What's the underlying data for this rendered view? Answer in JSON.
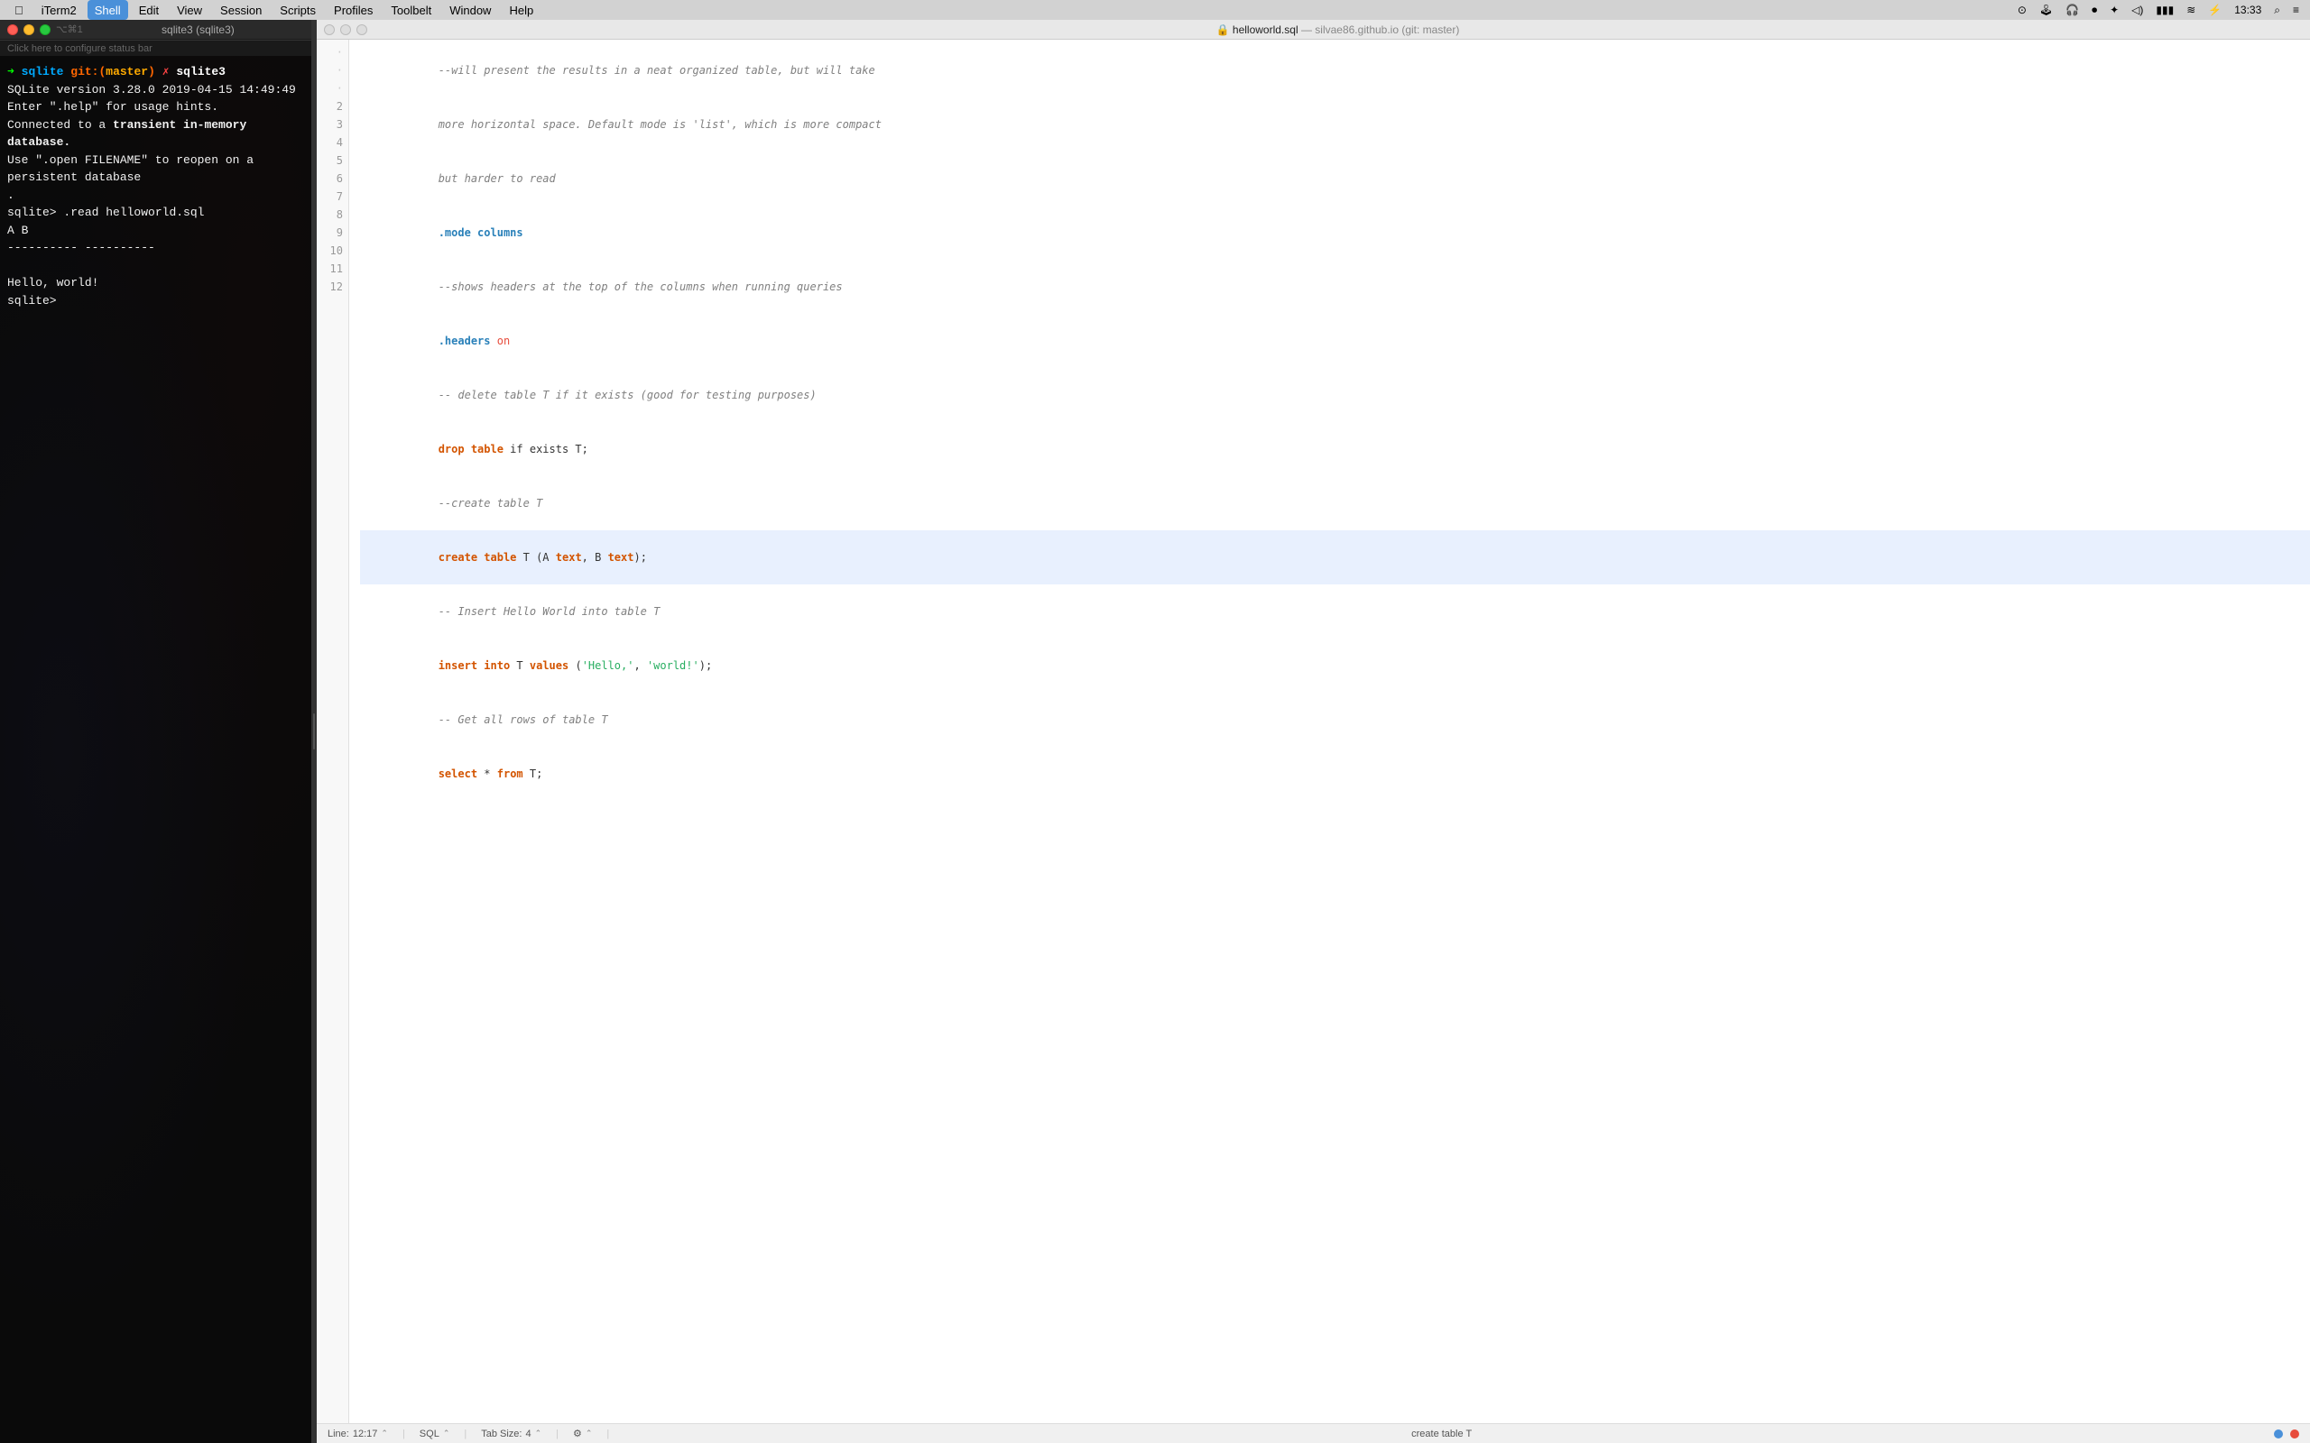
{
  "menubar": {
    "apple": "⌘",
    "items": [
      {
        "id": "iterm2",
        "label": "iTerm2"
      },
      {
        "id": "shell",
        "label": "Shell"
      },
      {
        "id": "edit",
        "label": "Edit"
      },
      {
        "id": "view",
        "label": "View"
      },
      {
        "id": "session",
        "label": "Session"
      },
      {
        "id": "scripts",
        "label": "Scripts"
      },
      {
        "id": "profiles",
        "label": "Profiles"
      },
      {
        "id": "toolbelt",
        "label": "Toolbelt"
      },
      {
        "id": "window",
        "label": "Window"
      },
      {
        "id": "help",
        "label": "Help"
      }
    ],
    "right": {
      "time": "13:33"
    }
  },
  "terminal": {
    "title": "sqlite3 (sqlite3)",
    "shortcut": "⌥⌘1",
    "status_bar_text": "Click here to configure status bar",
    "lines": [
      {
        "type": "prompt",
        "dir": "sqlite",
        "git_label": "git:(",
        "branch": "master",
        "git_close": ")",
        "cross": "✗",
        "cmd": "sqlite3"
      },
      {
        "type": "text",
        "content": "SQLite version 3.28.0 2019-04-15 14:49:49"
      },
      {
        "type": "text",
        "content": "Enter \".help\" for usage hints."
      },
      {
        "type": "text_mixed",
        "plain1": "Connected to a ",
        "bold": "transient in-memory database.",
        "plain2": ""
      },
      {
        "type": "text",
        "content": "Use \".open FILENAME\" to reopen on a persistent database"
      },
      {
        "type": "text",
        "content": "."
      },
      {
        "type": "sqlite_prompt",
        "cmd": ".read helloworld.sql"
      },
      {
        "type": "text",
        "content": "A               B"
      },
      {
        "type": "text",
        "content": "----------  ----------"
      },
      {
        "type": "text",
        "content": ""
      },
      {
        "type": "text",
        "content": "Hello,      world!"
      },
      {
        "type": "sqlite_empty_prompt",
        "content": ""
      }
    ]
  },
  "editor": {
    "title_dim1": "helloworld.sql",
    "title_dim2": " — silvae86.github.io (git: master)",
    "lines": [
      {
        "num": "·",
        "dot": true,
        "tokens": [
          {
            "type": "comment",
            "text": "--will present the results in a neat organized table, but will take"
          }
        ]
      },
      {
        "num": "·",
        "dot": true,
        "tokens": [
          {
            "type": "comment",
            "text": "more horizontal space. Default mode is 'list', which is more compact"
          }
        ]
      },
      {
        "num": "·",
        "dot": true,
        "tokens": [
          {
            "type": "comment",
            "text": "but harder to read"
          }
        ]
      },
      {
        "num": "2",
        "tokens": [
          {
            "type": "directive",
            "text": ".mode columns"
          }
        ]
      },
      {
        "num": "3",
        "tokens": [
          {
            "type": "comment",
            "text": "--shows headers at the top of the columns when running queries"
          }
        ]
      },
      {
        "num": "4",
        "tokens": [
          {
            "type": "directive",
            "text": ".headers "
          },
          {
            "type": "on",
            "text": "on"
          }
        ]
      },
      {
        "num": "5",
        "tokens": [
          {
            "type": "comment",
            "text": "-- delete table T if it exists (good for testing purposes)"
          }
        ]
      },
      {
        "num": "6",
        "tokens": [
          {
            "type": "keyword",
            "text": "drop table "
          },
          {
            "type": "normal",
            "text": "if exists T;"
          }
        ]
      },
      {
        "num": "7",
        "tokens": [
          {
            "type": "comment",
            "text": "--create table T"
          }
        ]
      },
      {
        "num": "8",
        "highlight": true,
        "tokens": [
          {
            "type": "keyword",
            "text": "create table "
          },
          {
            "type": "normal",
            "text": "T (A "
          },
          {
            "type": "keyword",
            "text": "text"
          },
          {
            "type": "normal",
            "text": ", B "
          },
          {
            "type": "keyword",
            "text": "text"
          },
          {
            "type": "normal",
            "text": ");"
          }
        ]
      },
      {
        "num": "9",
        "tokens": [
          {
            "type": "comment",
            "text": "-- Insert Hello World into table T"
          }
        ]
      },
      {
        "num": "10",
        "tokens": [
          {
            "type": "keyword",
            "text": "insert into"
          },
          {
            "type": "normal",
            "text": " T "
          },
          {
            "type": "keyword",
            "text": "values"
          },
          {
            "type": "normal",
            "text": " ("
          },
          {
            "type": "string",
            "text": "'Hello,'"
          },
          {
            "type": "normal",
            "text": ", "
          },
          {
            "type": "string",
            "text": "'world!'"
          },
          {
            "type": "normal",
            "text": ");"
          }
        ]
      },
      {
        "num": "11",
        "tokens": [
          {
            "type": "comment",
            "text": "-- Get all rows of table T"
          }
        ]
      },
      {
        "num": "12",
        "tokens": [
          {
            "type": "keyword",
            "text": "select"
          },
          {
            "type": "normal",
            "text": " * "
          },
          {
            "type": "keyword",
            "text": "from"
          },
          {
            "type": "normal",
            "text": " T;"
          }
        ]
      }
    ],
    "statusbar": {
      "line_label": "Line:",
      "line_value": "12:17",
      "lang_label": "SQL",
      "tab_label": "Tab Size:",
      "tab_value": "4",
      "function_label": "create table T"
    }
  }
}
